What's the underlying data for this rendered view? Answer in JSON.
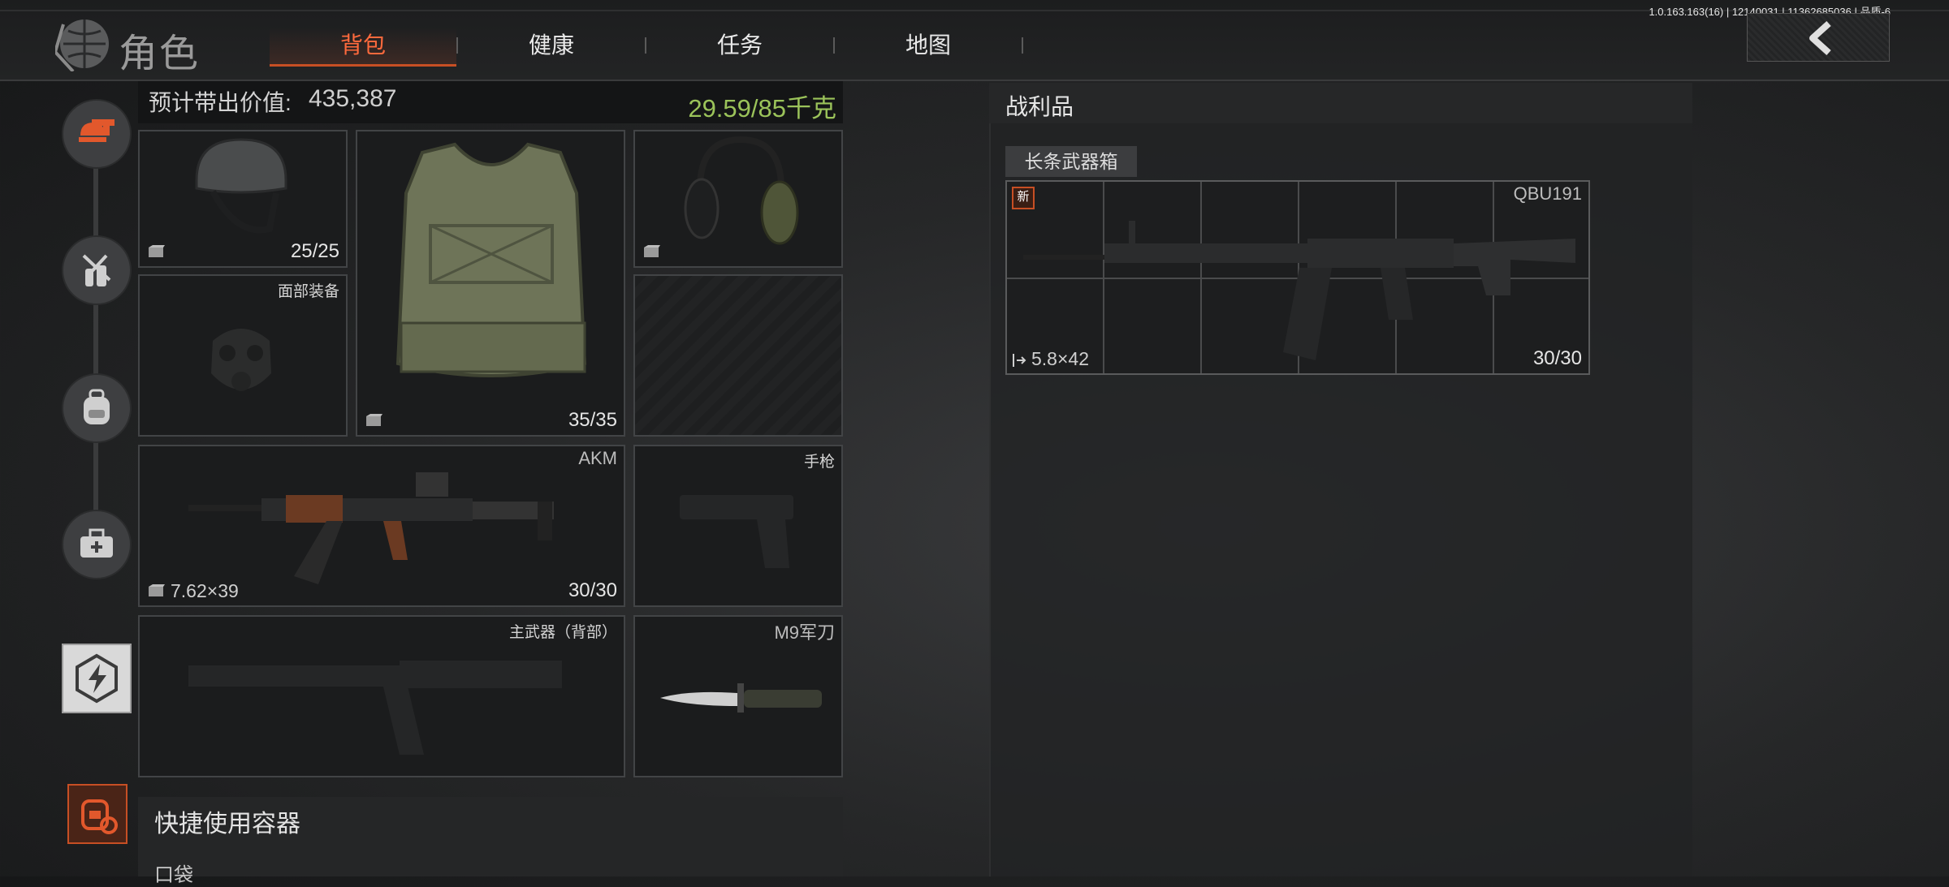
{
  "build_info": "1.0.163.163(16) | 12140031 | 11362685036 | 品质-6",
  "app": {
    "title": "角色"
  },
  "tabs": [
    {
      "label": "背包",
      "active": true
    },
    {
      "label": "健康",
      "active": false
    },
    {
      "label": "任务",
      "active": false
    },
    {
      "label": "地图",
      "active": false
    }
  ],
  "equipment": {
    "value_label": "预计带出价值:",
    "value": "435,387",
    "weight": "29.59/85千克",
    "weight_color": "#9bc35a",
    "helmet": {
      "count": "25/25"
    },
    "vest": {
      "count": "35/35"
    },
    "face_slot_label": "面部装备",
    "primary": {
      "name": "AKM",
      "ammo": "7.62×39",
      "count": "30/30"
    },
    "pistol_slot_label": "手枪",
    "secondary_slot_label": "主武器（背部）",
    "melee": {
      "name": "M9军刀"
    }
  },
  "quick_access": {
    "title": "快捷使用容器",
    "pocket_label": "口袋"
  },
  "loot": {
    "title": "战利品",
    "container_label": "长条武器箱",
    "item": {
      "new_badge": "新",
      "name": "QBU191",
      "ammo": "5.8×42",
      "count": "30/30"
    }
  },
  "colors": {
    "accent": "#ff6a3d",
    "accent_dark": "#c74f24"
  }
}
